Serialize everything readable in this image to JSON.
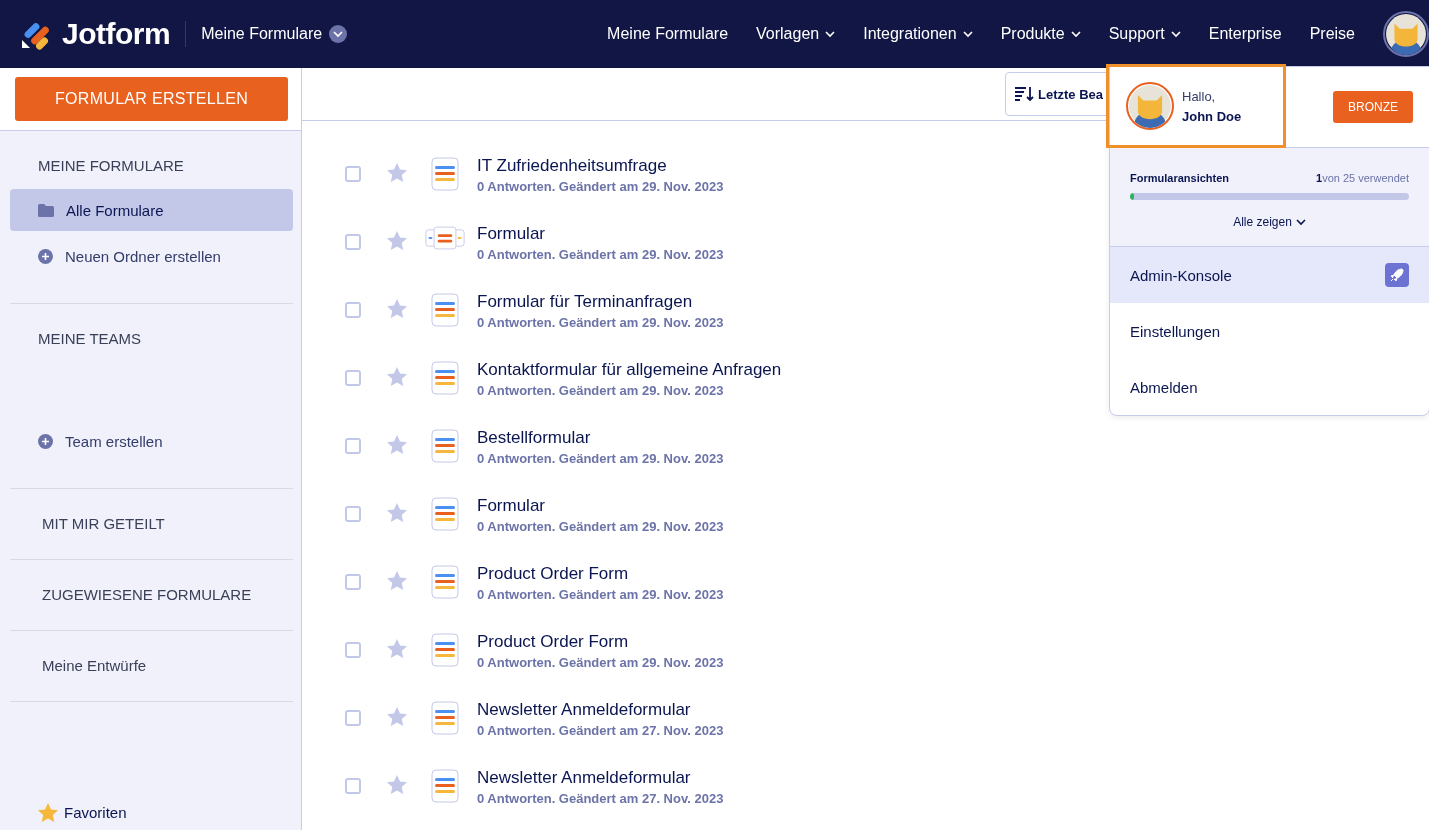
{
  "header": {
    "logo": "Jotform",
    "workspace": "Meine Formulare",
    "nav": [
      {
        "label": "Meine Formulare",
        "dropdown": false
      },
      {
        "label": "Vorlagen",
        "dropdown": true
      },
      {
        "label": "Integrationen",
        "dropdown": true
      },
      {
        "label": "Produkte",
        "dropdown": true
      },
      {
        "label": "Support",
        "dropdown": true
      },
      {
        "label": "Enterprise",
        "dropdown": false
      },
      {
        "label": "Preise",
        "dropdown": false
      }
    ]
  },
  "sidebar": {
    "create_button": "FORMULAR ERSTELLEN",
    "sections": [
      {
        "title": "MEINE FORMULARE",
        "items": [
          {
            "kind": "folder",
            "label": "Alle Formulare",
            "selected": true
          },
          {
            "kind": "add",
            "label": "Neuen Ordner erstellen",
            "selected": false
          }
        ]
      },
      {
        "title": "MEINE TEAMS",
        "items": [
          {
            "kind": "add",
            "label": "Team erstellen",
            "selected": false
          }
        ]
      },
      {
        "title": "MIT MIR GETEILT"
      },
      {
        "title": "ZUGEWIESENE FORMULARE"
      },
      {
        "title": "Meine Entwürfe"
      }
    ],
    "favorites": "Favoriten"
  },
  "toolbar": {
    "sort": "Letzte Bea"
  },
  "forms": [
    {
      "title": "IT Zufriedenheitsumfrage",
      "meta": "0 Antworten. Geändert am 29. Nov. 2023",
      "kind": "form",
      "checked": false,
      "starred": false
    },
    {
      "title": "Formular",
      "meta": "0 Antworten. Geändert am 29. Nov. 2023",
      "kind": "card",
      "checked": false,
      "starred": false
    },
    {
      "title": "Formular für Terminanfragen",
      "meta": "0 Antworten. Geändert am 29. Nov. 2023",
      "kind": "form",
      "checked": false,
      "starred": false
    },
    {
      "title": "Kontaktformular für allgemeine Anfragen",
      "meta": "0 Antworten. Geändert am 29. Nov. 2023",
      "kind": "form",
      "checked": false,
      "starred": false
    },
    {
      "title": "Bestellformular",
      "meta": "0 Antworten. Geändert am 29. Nov. 2023",
      "kind": "form",
      "checked": false,
      "starred": false
    },
    {
      "title": "Formular",
      "meta": "0 Antworten. Geändert am 29. Nov. 2023",
      "kind": "form",
      "checked": false,
      "starred": false
    },
    {
      "title": "Product Order Form",
      "meta": "0 Antworten. Geändert am 29. Nov. 2023",
      "kind": "form",
      "checked": false,
      "starred": false
    },
    {
      "title": "Product Order Form",
      "meta": "0 Antworten. Geändert am 29. Nov. 2023",
      "kind": "form",
      "checked": false,
      "starred": false
    },
    {
      "title": "Newsletter Anmeldeformular",
      "meta": "0 Antworten. Geändert am 27. Nov. 2023",
      "kind": "form",
      "checked": false,
      "starred": false
    },
    {
      "title": "Newsletter Anmeldeformular",
      "meta": "0 Antworten. Geändert am 27. Nov. 2023",
      "kind": "form",
      "checked": false,
      "starred": false
    }
  ],
  "account_menu": {
    "greeting": "Hallo,",
    "name": "John Doe",
    "plan": "BRONZE",
    "usage": {
      "label": "Formularansichten",
      "used": "1",
      "limit": "von 25 verwendet",
      "level": 0.015
    },
    "show_all": "Alle zeigen",
    "items": [
      {
        "label": "Admin-Konsole",
        "selected": true,
        "kind": "admin"
      },
      {
        "label": "Einstellungen",
        "selected": false,
        "kind": "plain"
      },
      {
        "label": "Abmelden",
        "selected": false,
        "kind": "plain"
      }
    ]
  }
}
